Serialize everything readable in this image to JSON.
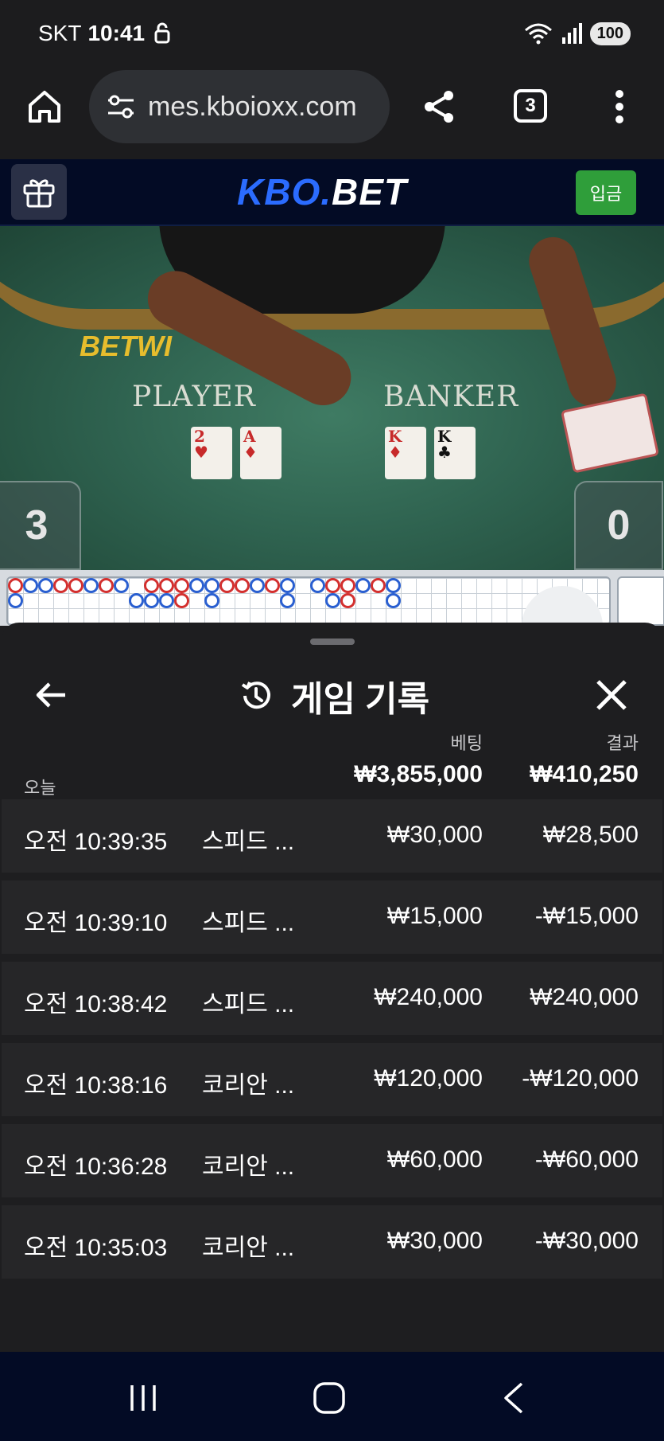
{
  "status_bar": {
    "carrier": "SKT",
    "time": "10:41",
    "battery": "100"
  },
  "browser": {
    "url": "mes.kboioxx.com",
    "tab_count": "3"
  },
  "site": {
    "logo_part1": "KBO.",
    "logo_part2": "BET",
    "deposit_label": "입금"
  },
  "live_table": {
    "brand": "BETWI",
    "player_label": "PLAYER",
    "banker_label": "BANKER",
    "player_cards": [
      {
        "rank": "2",
        "suit": "♥"
      },
      {
        "rank": "A",
        "suit": "♦"
      }
    ],
    "banker_cards": [
      {
        "rank": "K",
        "suit": "♦"
      },
      {
        "rank": "K",
        "suit": "♣"
      }
    ],
    "player_score": "3",
    "banker_score": "0"
  },
  "history": {
    "title": "게임 기록",
    "col_bet": "베팅",
    "col_result": "결과",
    "period_label": "오늘",
    "total_bet": "₩3,855,000",
    "total_result": "₩410,250",
    "rows": [
      {
        "time": "오전 10:39:35",
        "game": "스피드 ...",
        "bet": "₩30,000",
        "result": "₩28,500"
      },
      {
        "time": "오전 10:39:10",
        "game": "스피드 ...",
        "bet": "₩15,000",
        "result": "-₩15,000"
      },
      {
        "time": "오전 10:38:42",
        "game": "스피드 ...",
        "bet": "₩240,000",
        "result": "₩240,000"
      },
      {
        "time": "오전 10:38:16",
        "game": "코리안 ...",
        "bet": "₩120,000",
        "result": "-₩120,000"
      },
      {
        "time": "오전 10:36:28",
        "game": "코리안 ...",
        "bet": "₩60,000",
        "result": "-₩60,000"
      },
      {
        "time": "오전 10:35:03",
        "game": "코리안 ...",
        "bet": "₩30,000",
        "result": "-₩30,000"
      }
    ]
  },
  "colors": {
    "brand_blue": "#2b6cff",
    "deposit_green": "#2f9e3a",
    "banker_red": "#d3302f",
    "player_blue": "#2a5fd0"
  }
}
